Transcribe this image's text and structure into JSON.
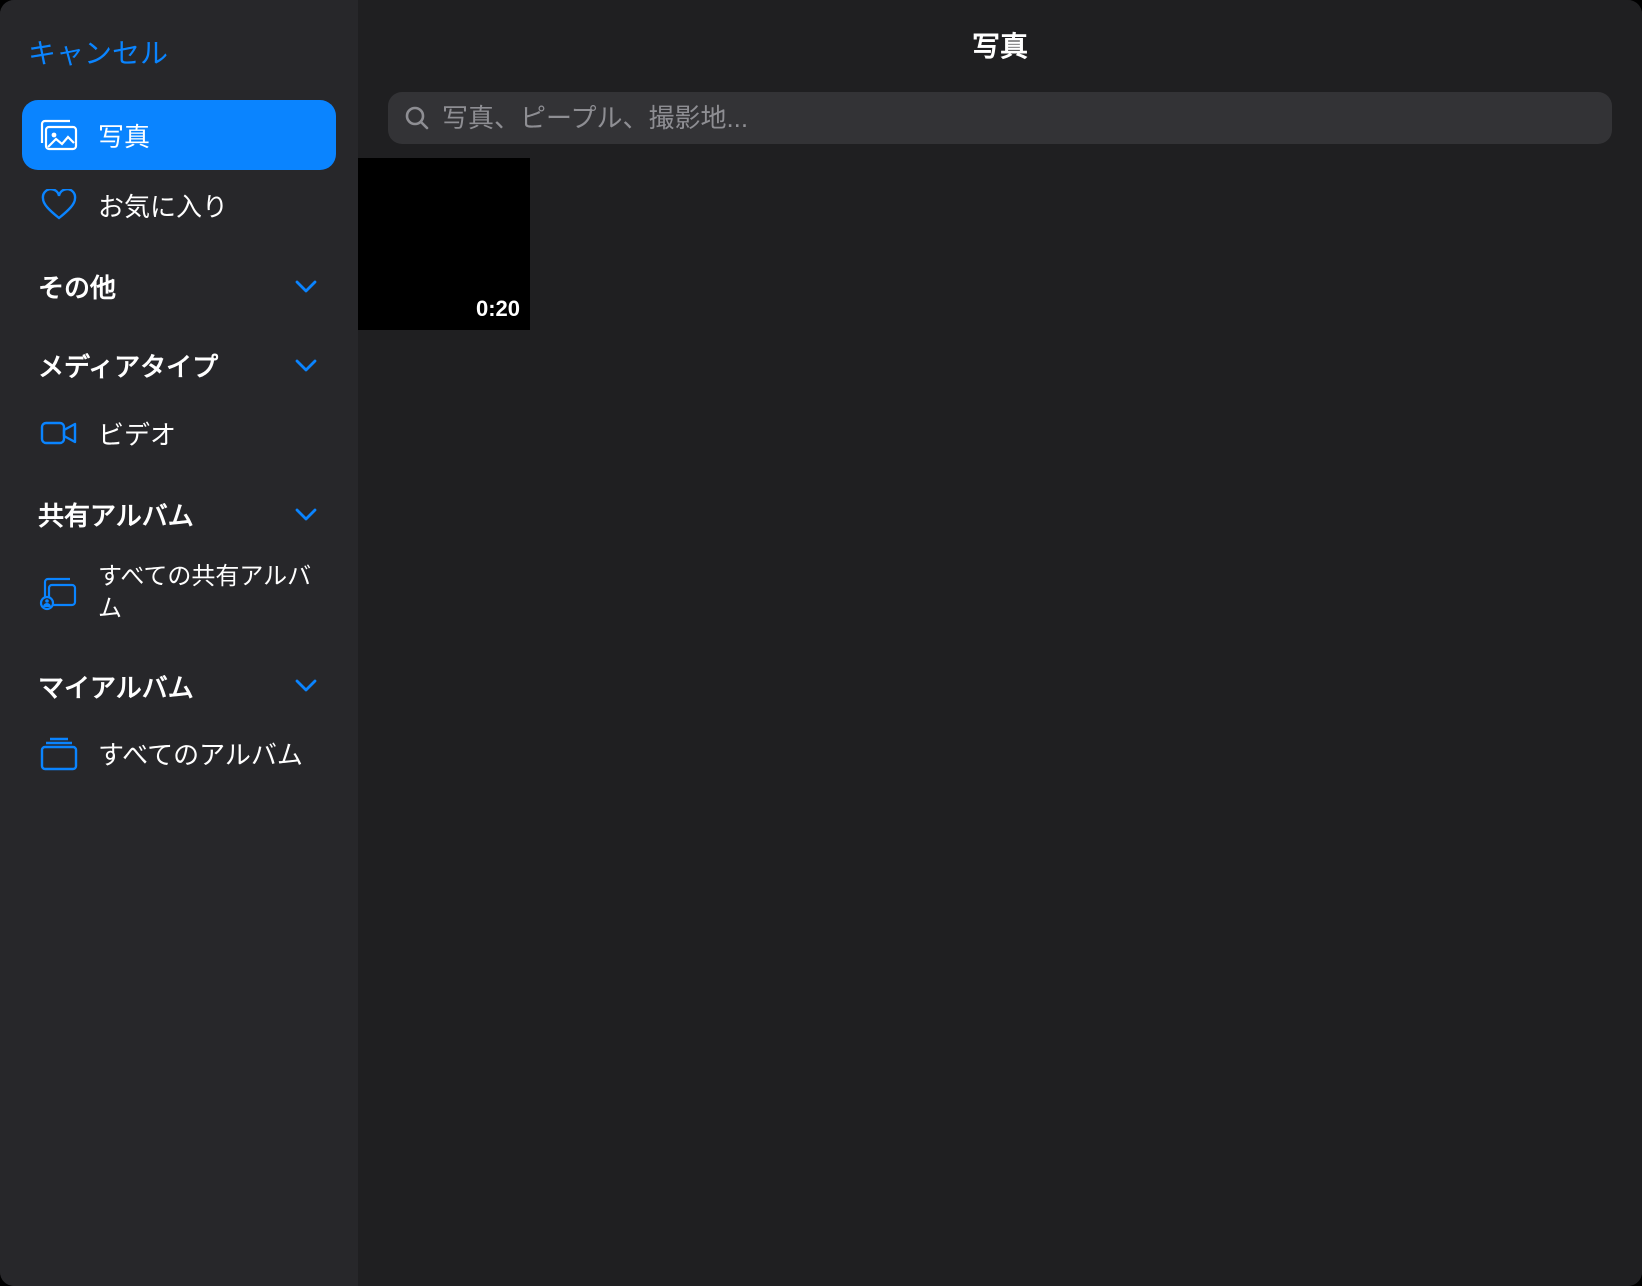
{
  "sidebar": {
    "cancel_label": "キャンセル",
    "items": {
      "photos": "写真",
      "favorites": "お気に入り",
      "videos": "ビデオ",
      "all_shared": "すべての共有アルバム",
      "all_albums": "すべてのアルバム"
    },
    "sections": {
      "other": "その他",
      "media_types": "メディアタイプ",
      "shared_albums": "共有アルバム",
      "my_albums": "マイアルバム"
    }
  },
  "main": {
    "title": "写真",
    "search_placeholder": "写真、ピープル、撮影地...",
    "grid": [
      {
        "duration": "0:20"
      }
    ]
  },
  "colors": {
    "accent": "#0a84ff"
  }
}
